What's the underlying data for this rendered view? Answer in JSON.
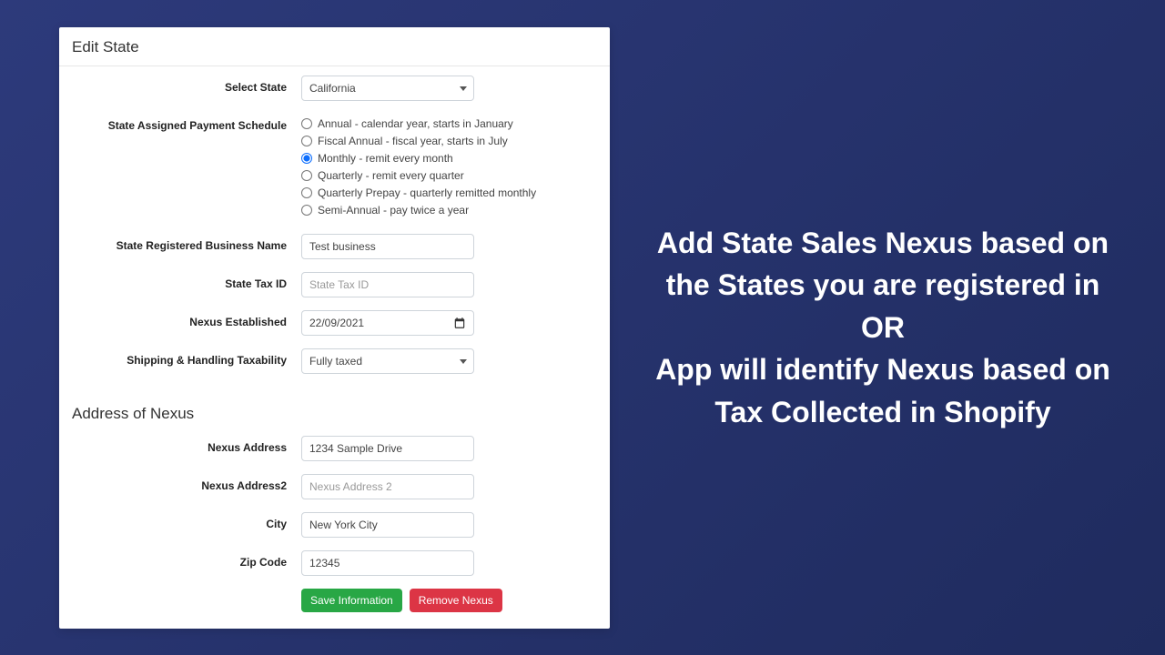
{
  "card": {
    "title": "Edit State",
    "labels": {
      "select_state": "Select State",
      "payment_schedule": "State Assigned Payment Schedule",
      "business_name": "State Registered Business Name",
      "state_tax_id": "State Tax ID",
      "nexus_established": "Nexus Established",
      "shipping_tax": "Shipping & Handling Taxability"
    },
    "values": {
      "state_selected": "California",
      "business_name": "Test business",
      "state_tax_id_placeholder": "State Tax ID",
      "nexus_date": "22/09/2021",
      "shipping_tax_selected": "Fully taxed"
    },
    "schedule_options": [
      {
        "label": "Annual - calendar year, starts in January",
        "checked": false
      },
      {
        "label": "Fiscal Annual - fiscal year, starts in July",
        "checked": false
      },
      {
        "label": "Monthly - remit every month",
        "checked": true
      },
      {
        "label": "Quarterly - remit every quarter",
        "checked": false
      },
      {
        "label": "Quarterly Prepay - quarterly remitted monthly",
        "checked": false
      },
      {
        "label": "Semi-Annual - pay twice a year",
        "checked": false
      }
    ],
    "address_section_title": "Address of Nexus",
    "address_labels": {
      "nexus_address": "Nexus Address",
      "nexus_address2": "Nexus Address2",
      "city": "City",
      "zip": "Zip Code"
    },
    "address_values": {
      "nexus_address": "1234 Sample Drive",
      "nexus_address2_placeholder": "Nexus Address 2",
      "city": "New York City",
      "zip": "12345"
    },
    "buttons": {
      "save": "Save Information",
      "remove": "Remove Nexus"
    }
  },
  "promo": {
    "text": "Add State Sales Nexus based on the States you are registered in OR\nApp will identify Nexus based on Tax Collected in Shopify"
  }
}
